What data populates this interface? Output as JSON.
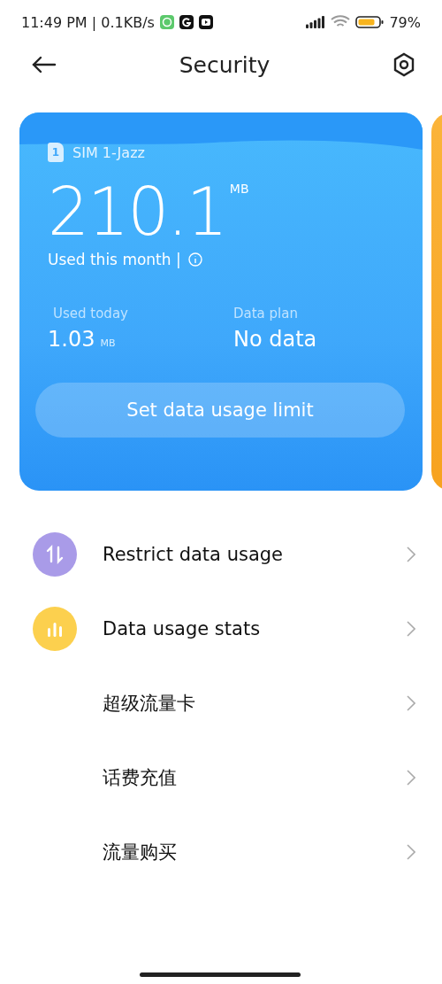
{
  "status_bar": {
    "time": "11:49 PM | 0.1KB/s",
    "battery": "79%"
  },
  "header": {
    "title": "Security"
  },
  "card": {
    "sim": "SIM 1-Jazz",
    "sim_number": "1",
    "used_month": "210.1",
    "used_month_unit": "MB",
    "used_month_label": "Used this month |",
    "used_today_label": "Used today",
    "used_today": "1.03",
    "used_today_unit": "MB",
    "plan_label": "Data plan",
    "plan": "No data",
    "button": "Set data usage limit"
  },
  "items": [
    {
      "kind": "icon",
      "label": "Restrict data usage",
      "color": "#a99be8"
    },
    {
      "kind": "icon",
      "label": "Data usage stats",
      "color": "#fcd04e"
    },
    {
      "kind": "text",
      "label": "超级流量卡"
    },
    {
      "kind": "text",
      "label": "话费充值"
    },
    {
      "kind": "text",
      "label": "流量购买"
    }
  ]
}
